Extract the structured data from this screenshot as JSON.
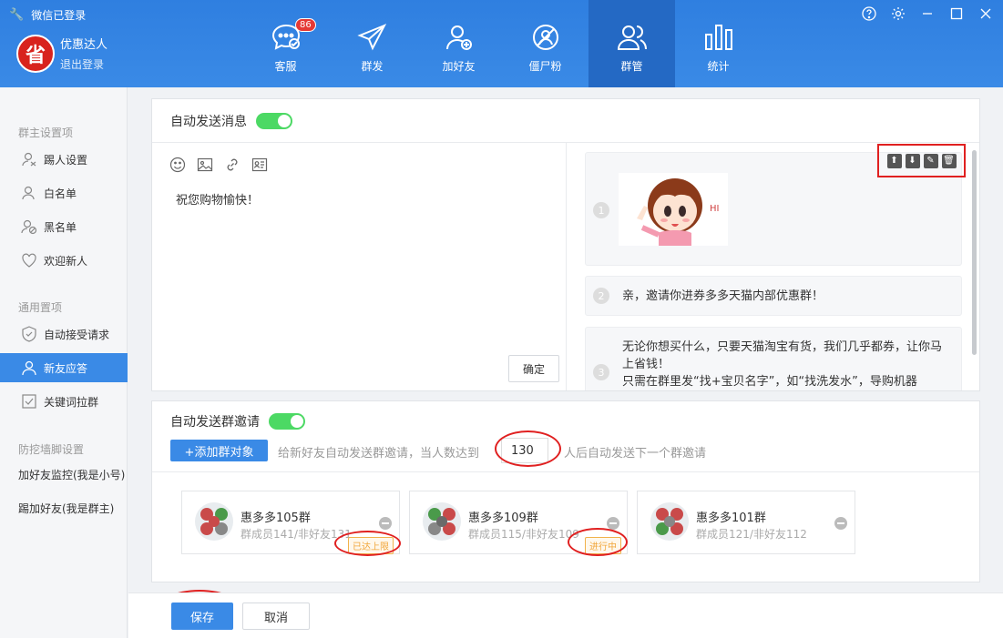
{
  "app": {
    "login_status": "微信已登录",
    "username": "优惠达人",
    "logout": "退出登录",
    "avatar_char": "省"
  },
  "nav": {
    "items": [
      {
        "label": "客服",
        "icon": "chat-icon",
        "badge": "86"
      },
      {
        "label": "群发",
        "icon": "send-icon"
      },
      {
        "label": "加好友",
        "icon": "add-friend-icon"
      },
      {
        "label": "僵尸粉",
        "icon": "zombie-fan-icon"
      },
      {
        "label": "群管",
        "icon": "group-manage-icon",
        "active": true
      },
      {
        "label": "统计",
        "icon": "stats-icon"
      }
    ]
  },
  "window_controls": [
    "help-icon",
    "gear-icon",
    "minimize-icon",
    "maximize-icon",
    "close-icon"
  ],
  "sidebar": {
    "group1": "群主设置项",
    "group1_items": [
      "踢人设置",
      "白名单",
      "黑名单",
      "欢迎新人"
    ],
    "group2": "通用置项",
    "group2_items": [
      "自动接受请求",
      "新友应答",
      "关键词拉群"
    ],
    "group3": "防挖墙脚设置",
    "group3_items": [
      "加好友监控(我是小号)",
      "踢加好友(我是群主)"
    ]
  },
  "auto_message": {
    "title": "自动发送消息",
    "enabled": true,
    "editor_text": "祝您购物愉快！",
    "confirm_label": "确定",
    "messages": [
      {
        "num": "1",
        "type": "image",
        "image_text": "HI"
      },
      {
        "num": "2",
        "text": "亲，邀请你进券多多天猫内部优惠群！"
      },
      {
        "num": "3",
        "text_line1": "无论你想买什么，只要天猫淘宝有货，我们几乎都券，让你马",
        "text_line2": "上省钱！",
        "text_line3": "只需在群里发“找+宝贝名字”，如“找洗发水”，导购机器"
      }
    ]
  },
  "group_invite": {
    "title": "自动发送群邀请",
    "enabled": true,
    "add_label": "+添加群对象",
    "hint_before": "给新好友自动发送群邀请，当人数达到",
    "count": "130",
    "hint_after": "人后自动发送下一个群邀请",
    "groups": [
      {
        "name": "惠多多105群",
        "sub": "群成员141/非好友131",
        "tag": "已达上限"
      },
      {
        "name": "惠多多109群",
        "sub": "群成员115/非好友109",
        "tag": "进行中"
      },
      {
        "name": "惠多多101群",
        "sub": "群成员121/非好友112",
        "tag": ""
      }
    ]
  },
  "footer": {
    "save": "保存",
    "cancel": "取消"
  },
  "colors": {
    "brand": "#3a8ae6",
    "toggle_on": "#4cd964",
    "highlight": "#e02020",
    "tag": "#f1a63a"
  }
}
